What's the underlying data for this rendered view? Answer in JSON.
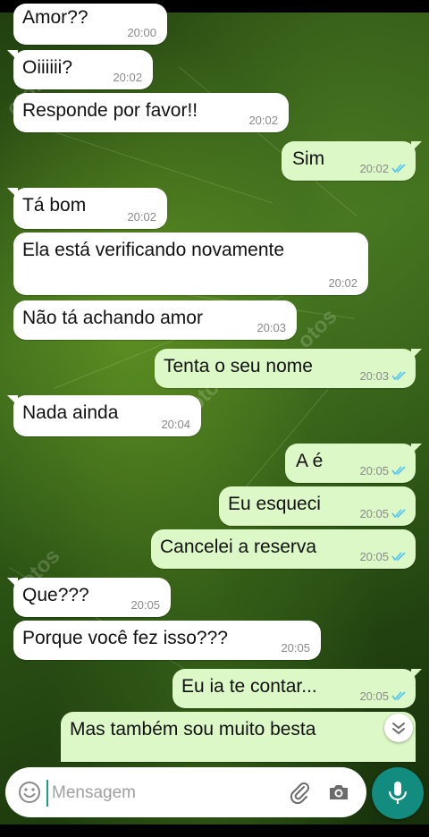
{
  "messages": [
    {
      "dir": "in",
      "text": "Amor??",
      "time": "20:00"
    },
    {
      "dir": "in",
      "text": "Oiiiiii?",
      "time": "20:02"
    },
    {
      "dir": "in",
      "text": "Responde por favor!!",
      "time": "20:02"
    },
    {
      "dir": "out",
      "text": "Sim",
      "time": "20:02"
    },
    {
      "dir": "in",
      "text": "Tá bom",
      "time": "20:02"
    },
    {
      "dir": "in",
      "text": "Ela está verificando novamente",
      "time": "20:02"
    },
    {
      "dir": "in",
      "text": "Não tá achando amor",
      "time": "20:03"
    },
    {
      "dir": "out",
      "text": "Tenta o seu nome",
      "time": "20:03"
    },
    {
      "dir": "in",
      "text": "Nada ainda",
      "time": "20:04"
    },
    {
      "dir": "out",
      "text": "A é",
      "time": "20:05"
    },
    {
      "dir": "out",
      "text": "Eu esqueci",
      "time": "20:05"
    },
    {
      "dir": "out",
      "text": "Cancelei a reserva",
      "time": "20:05"
    },
    {
      "dir": "in",
      "text": "Que???",
      "time": "20:05"
    },
    {
      "dir": "in",
      "text": "Porque você fez isso???",
      "time": "20:05"
    },
    {
      "dir": "out",
      "text": "Eu ia te contar...",
      "time": "20:05"
    },
    {
      "dir": "out",
      "text": "Mas também sou muito besta",
      "time": ""
    }
  ],
  "composer": {
    "placeholder": "Mensagem",
    "emoji_icon": "emoji-icon",
    "attach_icon": "paperclip-icon",
    "camera_icon": "camera-icon",
    "send_icon": "microphone-icon"
  },
  "watermark": "otos",
  "colors": {
    "incoming_bubble": "#ffffff",
    "outgoing_bubble": "#dcf8c6",
    "read_ticks": "#4fc3f7",
    "mic_button": "#128c7e"
  }
}
